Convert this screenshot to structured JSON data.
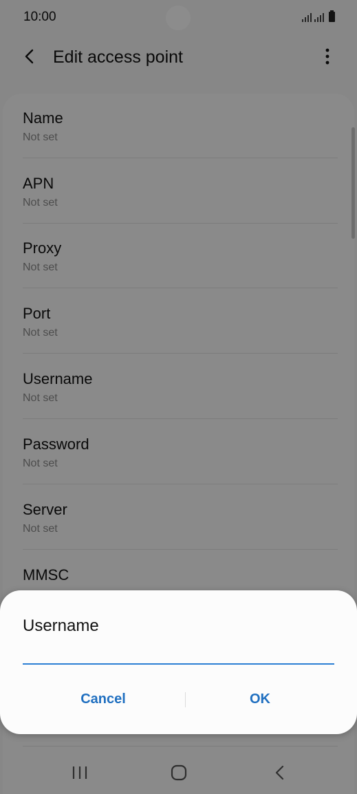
{
  "status_bar": {
    "time": "10:00"
  },
  "app_bar": {
    "title": "Edit access point",
    "back_icon": "chevron-left-icon",
    "more_icon": "more-vertical-icon"
  },
  "settings": {
    "items": [
      {
        "title": "Name",
        "value": "Not set"
      },
      {
        "title": "APN",
        "value": "Not set"
      },
      {
        "title": "Proxy",
        "value": "Not set"
      },
      {
        "title": "Port",
        "value": "Not set"
      },
      {
        "title": "Username",
        "value": "Not set"
      },
      {
        "title": "Password",
        "value": "Not set"
      },
      {
        "title": "Server",
        "value": "Not set"
      },
      {
        "title": "MMSC",
        "value": ""
      }
    ]
  },
  "dialog": {
    "title": "Username",
    "input_value": "",
    "cancel_label": "Cancel",
    "ok_label": "OK"
  },
  "colors": {
    "accent": "#1f6fc0",
    "input_underline": "#2a7fd3"
  }
}
